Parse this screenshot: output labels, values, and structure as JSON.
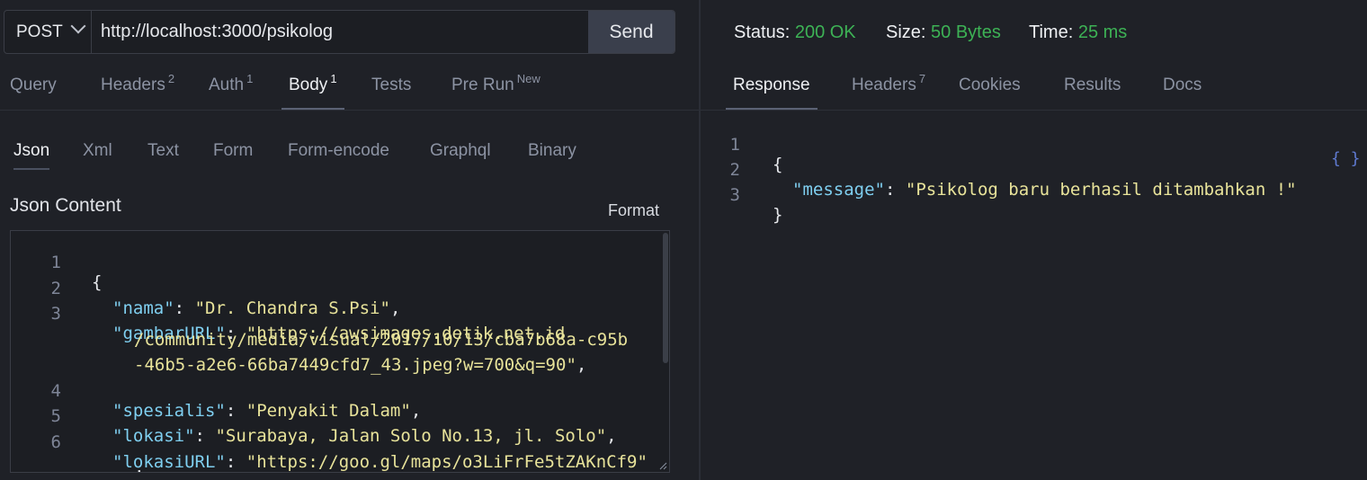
{
  "request": {
    "method": "POST",
    "url": "http://localhost:3000/psikolog",
    "send_label": "Send"
  },
  "tabs": [
    {
      "label": "Query",
      "sup": ""
    },
    {
      "label": "Headers",
      "sup": "2"
    },
    {
      "label": "Auth",
      "sup": "1"
    },
    {
      "label": "Body",
      "sup": "1"
    },
    {
      "label": "Tests",
      "sup": ""
    },
    {
      "label": "Pre Run",
      "sup": "New"
    }
  ],
  "body_tabs": [
    "Json",
    "Xml",
    "Text",
    "Form",
    "Form-encode",
    "Graphql",
    "Binary"
  ],
  "json_content_title": "Json Content",
  "format_label": "Format",
  "editor_lines": [
    {
      "num": "1"
    },
    {
      "num": "2",
      "key": "nama",
      "value": "Dr. Chandra S.Psi"
    },
    {
      "num": "3",
      "key": "gambarURL",
      "value_start": "https://awsimages.detik.net.id"
    },
    {
      "num": "",
      "text": "/community/media/visual/2017/10/13/cba7b68a-c95b"
    },
    {
      "num": "",
      "text": "-46b5-a2e6-66ba7449cfd7_43.jpeg?w=700&q=90"
    },
    {
      "num": "4",
      "key": "spesialis",
      "value": "Penyakit Dalam"
    },
    {
      "num": "5",
      "key": "lokasi",
      "value": "Surabaya, Jalan Solo No.13, jl. Solo"
    },
    {
      "num": "6",
      "key": "lokasiURL",
      "value": "https://goo.gl/maps/o3LiFrFe5tZAKnCf9"
    }
  ],
  "response_status": {
    "status_label": "Status:",
    "status_value": "200 OK",
    "size_label": "Size:",
    "size_value": "50 Bytes",
    "time_label": "Time:",
    "time_value": "25 ms"
  },
  "response_tabs": [
    {
      "label": "Response",
      "sup": ""
    },
    {
      "label": "Headers",
      "sup": "7"
    },
    {
      "label": "Cookies",
      "sup": ""
    },
    {
      "label": "Results",
      "sup": ""
    },
    {
      "label": "Docs",
      "sup": ""
    }
  ],
  "braces_label": "{ }",
  "response_body": {
    "lines": [
      "1",
      "2",
      "3"
    ],
    "key": "message",
    "value": "Psikolog baru berhasil ditambahkan !"
  }
}
